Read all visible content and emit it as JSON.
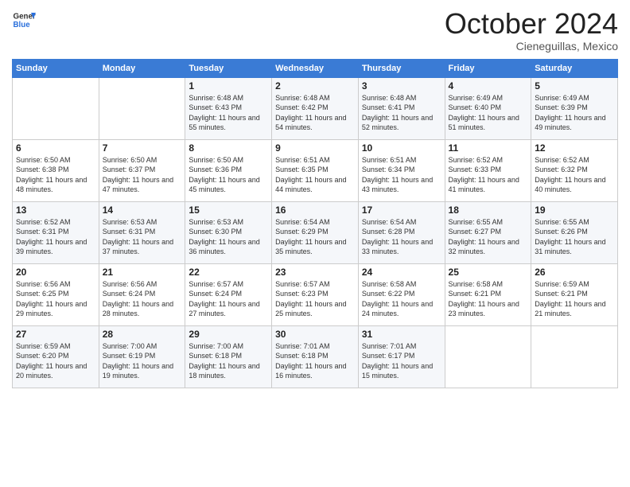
{
  "logo": {
    "general": "General",
    "blue": "Blue"
  },
  "header": {
    "month": "October 2024",
    "location": "Cieneguillas, Mexico"
  },
  "weekdays": [
    "Sunday",
    "Monday",
    "Tuesday",
    "Wednesday",
    "Thursday",
    "Friday",
    "Saturday"
  ],
  "weeks": [
    [
      {
        "day": "",
        "sunrise": "",
        "sunset": "",
        "daylight": ""
      },
      {
        "day": "",
        "sunrise": "",
        "sunset": "",
        "daylight": ""
      },
      {
        "day": "1",
        "sunrise": "Sunrise: 6:48 AM",
        "sunset": "Sunset: 6:43 PM",
        "daylight": "Daylight: 11 hours and 55 minutes."
      },
      {
        "day": "2",
        "sunrise": "Sunrise: 6:48 AM",
        "sunset": "Sunset: 6:42 PM",
        "daylight": "Daylight: 11 hours and 54 minutes."
      },
      {
        "day": "3",
        "sunrise": "Sunrise: 6:48 AM",
        "sunset": "Sunset: 6:41 PM",
        "daylight": "Daylight: 11 hours and 52 minutes."
      },
      {
        "day": "4",
        "sunrise": "Sunrise: 6:49 AM",
        "sunset": "Sunset: 6:40 PM",
        "daylight": "Daylight: 11 hours and 51 minutes."
      },
      {
        "day": "5",
        "sunrise": "Sunrise: 6:49 AM",
        "sunset": "Sunset: 6:39 PM",
        "daylight": "Daylight: 11 hours and 49 minutes."
      }
    ],
    [
      {
        "day": "6",
        "sunrise": "Sunrise: 6:50 AM",
        "sunset": "Sunset: 6:38 PM",
        "daylight": "Daylight: 11 hours and 48 minutes."
      },
      {
        "day": "7",
        "sunrise": "Sunrise: 6:50 AM",
        "sunset": "Sunset: 6:37 PM",
        "daylight": "Daylight: 11 hours and 47 minutes."
      },
      {
        "day": "8",
        "sunrise": "Sunrise: 6:50 AM",
        "sunset": "Sunset: 6:36 PM",
        "daylight": "Daylight: 11 hours and 45 minutes."
      },
      {
        "day": "9",
        "sunrise": "Sunrise: 6:51 AM",
        "sunset": "Sunset: 6:35 PM",
        "daylight": "Daylight: 11 hours and 44 minutes."
      },
      {
        "day": "10",
        "sunrise": "Sunrise: 6:51 AM",
        "sunset": "Sunset: 6:34 PM",
        "daylight": "Daylight: 11 hours and 43 minutes."
      },
      {
        "day": "11",
        "sunrise": "Sunrise: 6:52 AM",
        "sunset": "Sunset: 6:33 PM",
        "daylight": "Daylight: 11 hours and 41 minutes."
      },
      {
        "day": "12",
        "sunrise": "Sunrise: 6:52 AM",
        "sunset": "Sunset: 6:32 PM",
        "daylight": "Daylight: 11 hours and 40 minutes."
      }
    ],
    [
      {
        "day": "13",
        "sunrise": "Sunrise: 6:52 AM",
        "sunset": "Sunset: 6:31 PM",
        "daylight": "Daylight: 11 hours and 39 minutes."
      },
      {
        "day": "14",
        "sunrise": "Sunrise: 6:53 AM",
        "sunset": "Sunset: 6:31 PM",
        "daylight": "Daylight: 11 hours and 37 minutes."
      },
      {
        "day": "15",
        "sunrise": "Sunrise: 6:53 AM",
        "sunset": "Sunset: 6:30 PM",
        "daylight": "Daylight: 11 hours and 36 minutes."
      },
      {
        "day": "16",
        "sunrise": "Sunrise: 6:54 AM",
        "sunset": "Sunset: 6:29 PM",
        "daylight": "Daylight: 11 hours and 35 minutes."
      },
      {
        "day": "17",
        "sunrise": "Sunrise: 6:54 AM",
        "sunset": "Sunset: 6:28 PM",
        "daylight": "Daylight: 11 hours and 33 minutes."
      },
      {
        "day": "18",
        "sunrise": "Sunrise: 6:55 AM",
        "sunset": "Sunset: 6:27 PM",
        "daylight": "Daylight: 11 hours and 32 minutes."
      },
      {
        "day": "19",
        "sunrise": "Sunrise: 6:55 AM",
        "sunset": "Sunset: 6:26 PM",
        "daylight": "Daylight: 11 hours and 31 minutes."
      }
    ],
    [
      {
        "day": "20",
        "sunrise": "Sunrise: 6:56 AM",
        "sunset": "Sunset: 6:25 PM",
        "daylight": "Daylight: 11 hours and 29 minutes."
      },
      {
        "day": "21",
        "sunrise": "Sunrise: 6:56 AM",
        "sunset": "Sunset: 6:24 PM",
        "daylight": "Daylight: 11 hours and 28 minutes."
      },
      {
        "day": "22",
        "sunrise": "Sunrise: 6:57 AM",
        "sunset": "Sunset: 6:24 PM",
        "daylight": "Daylight: 11 hours and 27 minutes."
      },
      {
        "day": "23",
        "sunrise": "Sunrise: 6:57 AM",
        "sunset": "Sunset: 6:23 PM",
        "daylight": "Daylight: 11 hours and 25 minutes."
      },
      {
        "day": "24",
        "sunrise": "Sunrise: 6:58 AM",
        "sunset": "Sunset: 6:22 PM",
        "daylight": "Daylight: 11 hours and 24 minutes."
      },
      {
        "day": "25",
        "sunrise": "Sunrise: 6:58 AM",
        "sunset": "Sunset: 6:21 PM",
        "daylight": "Daylight: 11 hours and 23 minutes."
      },
      {
        "day": "26",
        "sunrise": "Sunrise: 6:59 AM",
        "sunset": "Sunset: 6:21 PM",
        "daylight": "Daylight: 11 hours and 21 minutes."
      }
    ],
    [
      {
        "day": "27",
        "sunrise": "Sunrise: 6:59 AM",
        "sunset": "Sunset: 6:20 PM",
        "daylight": "Daylight: 11 hours and 20 minutes."
      },
      {
        "day": "28",
        "sunrise": "Sunrise: 7:00 AM",
        "sunset": "Sunset: 6:19 PM",
        "daylight": "Daylight: 11 hours and 19 minutes."
      },
      {
        "day": "29",
        "sunrise": "Sunrise: 7:00 AM",
        "sunset": "Sunset: 6:18 PM",
        "daylight": "Daylight: 11 hours and 18 minutes."
      },
      {
        "day": "30",
        "sunrise": "Sunrise: 7:01 AM",
        "sunset": "Sunset: 6:18 PM",
        "daylight": "Daylight: 11 hours and 16 minutes."
      },
      {
        "day": "31",
        "sunrise": "Sunrise: 7:01 AM",
        "sunset": "Sunset: 6:17 PM",
        "daylight": "Daylight: 11 hours and 15 minutes."
      },
      {
        "day": "",
        "sunrise": "",
        "sunset": "",
        "daylight": ""
      },
      {
        "day": "",
        "sunrise": "",
        "sunset": "",
        "daylight": ""
      }
    ]
  ]
}
